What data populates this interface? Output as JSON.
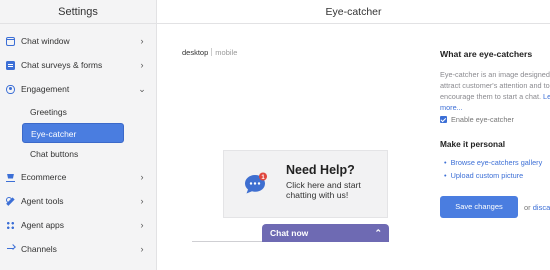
{
  "sidebar": {
    "title": "Settings",
    "items": [
      {
        "label": "Chat window",
        "icon": "chat-window-icon"
      },
      {
        "label": "Chat surveys & forms",
        "icon": "survey-icon"
      },
      {
        "label": "Engagement",
        "icon": "eye-icon"
      },
      {
        "label": "Ecommerce",
        "icon": "cart-icon"
      },
      {
        "label": "Agent tools",
        "icon": "wrench-icon"
      },
      {
        "label": "Agent apps",
        "icon": "apps-icon"
      },
      {
        "label": "Channels",
        "icon": "channels-icon"
      }
    ],
    "sub_items": [
      "Greetings",
      "Eye-catcher",
      "Chat buttons"
    ],
    "active_sub_item": "Eye-catcher"
  },
  "main": {
    "title": "Eye-catcher",
    "tabs": {
      "desktop": "desktop",
      "mobile": "mobile"
    },
    "preview": {
      "eyecatcher_title": "Need Help?",
      "eyecatcher_body": "Click here and start chatting with us!",
      "notification_count": "1",
      "chat_bar_label": "Chat now",
      "chat_bar_color": "#6e6ab3"
    }
  },
  "panel": {
    "title": "What are eye-catchers",
    "description": "Eye-catcher is an image designed to attract customer's attention and to encourage them to start a chat.",
    "learn_more": "Learn more...",
    "checkbox_label": "Enable eye-catcher",
    "checkbox_checked": true,
    "personal_title": "Make it personal",
    "links": [
      "Browse eye-catchers gallery",
      "Upload custom picture"
    ],
    "save_button": "Save changes",
    "or_text": "or",
    "discard": "discard"
  },
  "colors": {
    "accent": "#4a7de0",
    "icon": "#3c6fd6"
  }
}
